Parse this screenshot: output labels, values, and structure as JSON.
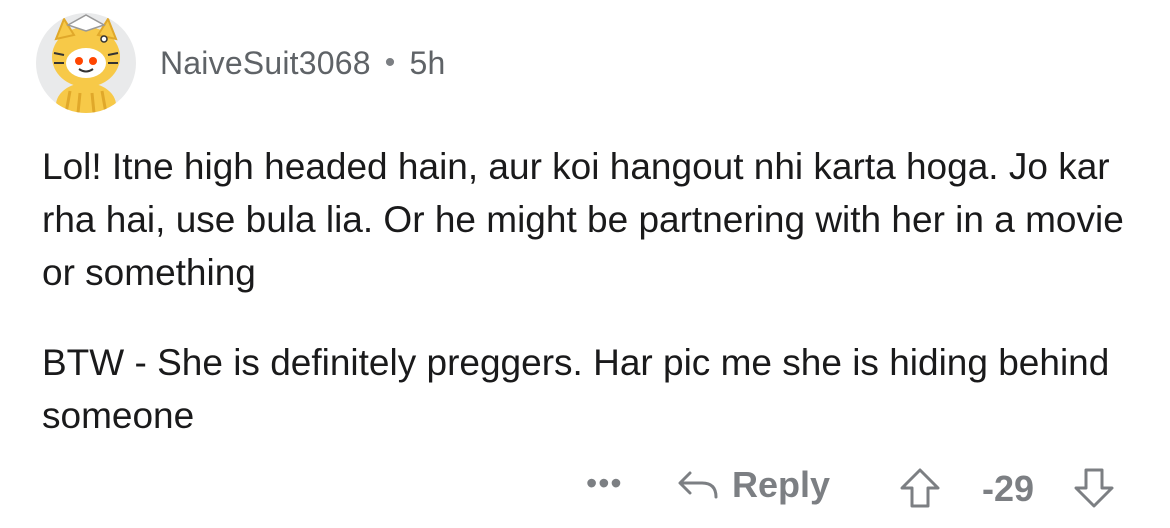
{
  "comment": {
    "author": "NaiveSuit3068",
    "separator": "•",
    "age": "5h",
    "paragraphs": [
      "Lol! Itne high headed hain, aur koi hangout nhi karta hoga. Jo kar rha hai, use bula lia. Or he might be partnering with her in a movie or something",
      "BTW - She is definitely preggers. Har pic me she is hiding behind someone"
    ]
  },
  "actions": {
    "more_label": "•••",
    "reply_label": "Reply",
    "score": "-29"
  },
  "icons": {
    "avatar": "snoo-avatar-icon",
    "reply": "reply-arrow-icon",
    "upvote": "upvote-arrow-icon",
    "downvote": "downvote-arrow-icon"
  },
  "colors": {
    "text": "#1a1a1b",
    "meta": "#5f6367",
    "action": "#7c7f83",
    "avatar_bg": "#e9eaeb"
  }
}
